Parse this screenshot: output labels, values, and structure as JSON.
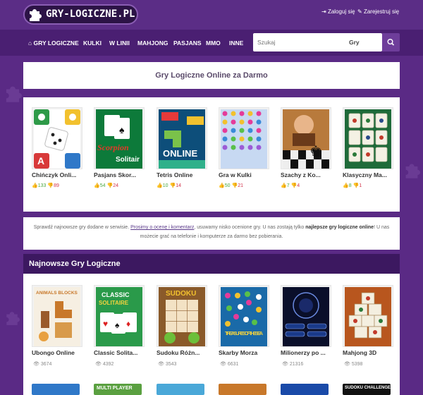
{
  "header": {
    "logo_text": "GRY-LOGICZNE.PL",
    "login": "Zaloguj się",
    "register": "Zarejestruj się"
  },
  "nav": {
    "items": [
      "GRY LOGICZNE",
      "KULKI",
      "W LINII",
      "MAHJONG",
      "PASJANS",
      "MMO",
      "INNE"
    ],
    "search_placeholder": "Szukaj",
    "search_category": "Gry"
  },
  "page_title": "Gry Logiczne Online za Darmo",
  "featured": [
    {
      "name": "Chińczyk Onli...",
      "likes": "133",
      "dislikes": "89"
    },
    {
      "name": "Pasjans Skor...",
      "likes": "54",
      "dislikes": "24"
    },
    {
      "name": "Tetris Online",
      "likes": "10",
      "dislikes": "14"
    },
    {
      "name": "Gra w Kulki",
      "likes": "50",
      "dislikes": "21"
    },
    {
      "name": "Szachy z Ko...",
      "likes": "7",
      "dislikes": "4"
    },
    {
      "name": "Klasyczny Ma...",
      "likes": "8",
      "dislikes": "1"
    }
  ],
  "info": {
    "part1": "Sprawdź najnowsze gry dodane w serwisie.",
    "link": "Prosimy o ocenę i komentarz",
    "part2": ", usuwamy nisko ocenione gry. U nas zostają tylko",
    "bold": "najlepsze gry logiczne online",
    "part3": "! U nas możecie grać na telefonie i komputerze za darmo bez pobierania."
  },
  "newest": {
    "title": "Najnowsze Gry Logiczne",
    "games": [
      {
        "name": "Ubongo Online",
        "views": "3674"
      },
      {
        "name": "Classic Solita...",
        "views": "4392"
      },
      {
        "name": "Sudoku Różn...",
        "views": "3543"
      },
      {
        "name": "Skarby Morza",
        "views": "6631"
      },
      {
        "name": "Milionerzy po ...",
        "views": "21316"
      },
      {
        "name": "Mahjong 3D",
        "views": "5398"
      }
    ]
  },
  "thumb_text": {
    "scorpion": "Scorpion",
    "solitaire": "Solitair",
    "online": "ONLINE",
    "animals_blocks": "ANIMALS BLOCKS",
    "classic": "CLASSIC",
    "solitaire2": "SOLITAIRE",
    "sudoku": "SUDOKU",
    "treasures": "TREASURES OF THE SEA",
    "multi": "MULTI PLAYER",
    "challenge": "SUDOKU CHALLENGES"
  }
}
